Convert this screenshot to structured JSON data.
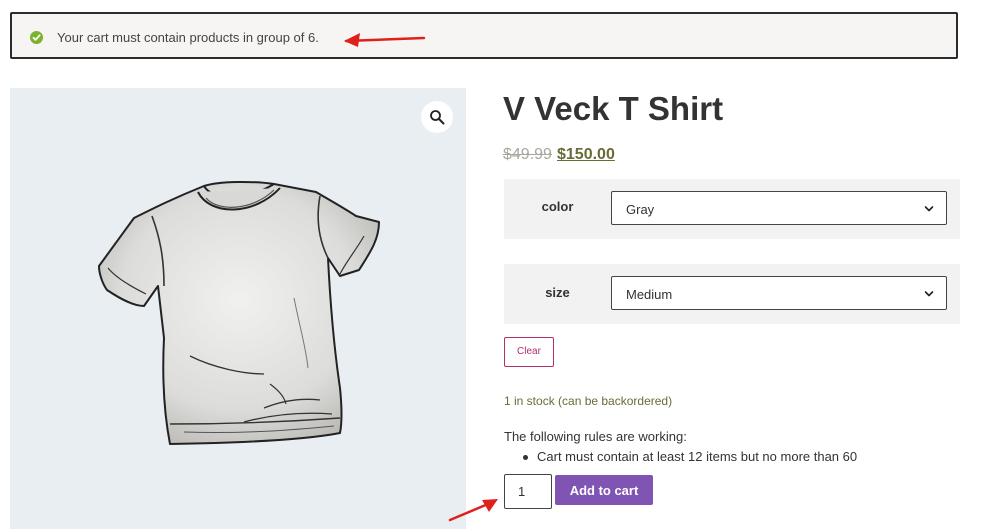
{
  "notice": {
    "message": "Your cart must contain products in group of 6.",
    "icon": "check-circle-icon",
    "accent": "#7ab32e"
  },
  "product": {
    "title": "V Veck T Shirt",
    "price_old": "$49.99",
    "price_new": "$150.00",
    "image_icon": "tshirt-illustration",
    "zoom_icon": "magnifier-icon"
  },
  "variations": [
    {
      "label": "color",
      "value": "Gray"
    },
    {
      "label": "size",
      "value": "Medium"
    }
  ],
  "clear_label": "Clear",
  "stock_text": "1 in stock (can be backordered)",
  "rules": {
    "heading": "The following rules are working:",
    "items": [
      "Cart must contain at least 12 items but no more than 60"
    ]
  },
  "quantity": "1",
  "add_to_cart_label": "Add to cart",
  "colors": {
    "button": "#7f54b3",
    "clear": "#b0306a",
    "price": "#6b6b35",
    "annotation_arrow": "#e0201b"
  }
}
